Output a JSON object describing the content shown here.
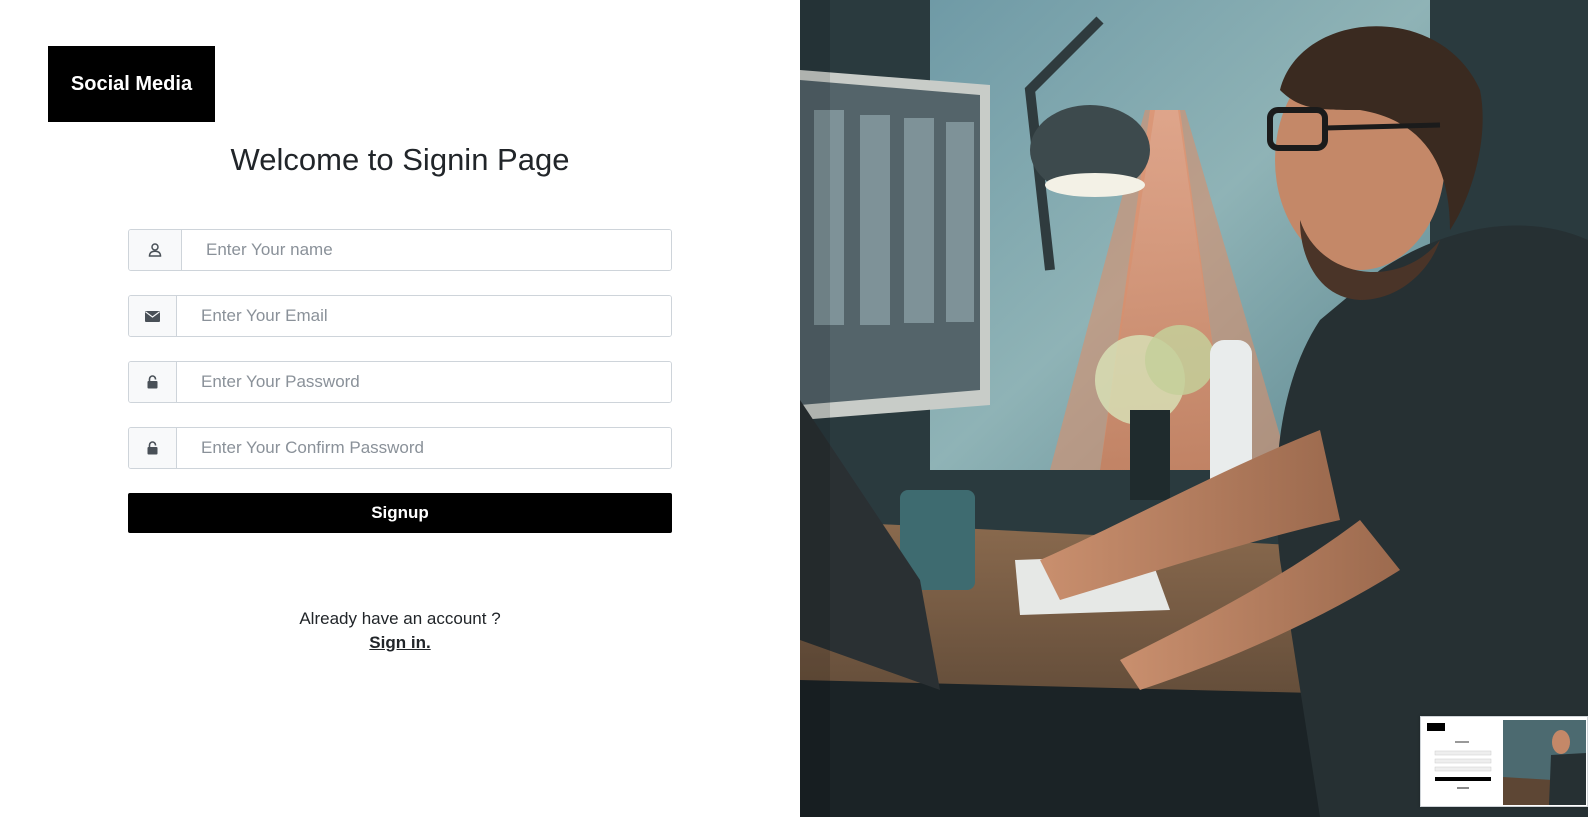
{
  "brand": {
    "label": "Social Media"
  },
  "title": "Welcome to Signin Page",
  "form": {
    "fields": [
      {
        "icon": "user-icon",
        "placeholder": "Enter Your name"
      },
      {
        "icon": "envelope-icon",
        "placeholder": "Enter Your Email"
      },
      {
        "icon": "lock-icon",
        "placeholder": "Enter Your Password"
      },
      {
        "icon": "lock-icon",
        "placeholder": "Enter Your Confirm Password"
      }
    ],
    "submit_label": "Signup"
  },
  "footer": {
    "prompt": "Already have an account ?",
    "link_label": "Sign in."
  },
  "hero_image": {
    "subject": "man-at-desk-with-monitor-photo"
  },
  "colors": {
    "brand_bg": "#000000",
    "button_bg": "#000000",
    "border": "#ced4da",
    "placeholder": "#8a9199"
  }
}
